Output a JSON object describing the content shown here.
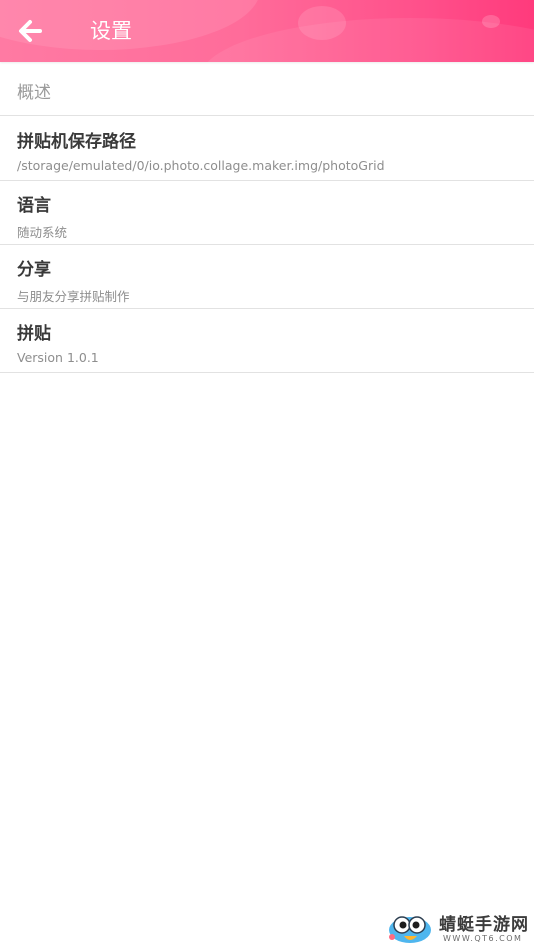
{
  "header": {
    "back_icon": "arrow-left-icon",
    "title": "设置",
    "gradient_colors": [
      "#ff7aa3",
      "#ff3a7c"
    ]
  },
  "section": {
    "label": "概述"
  },
  "preferences": [
    {
      "title": "拼贴机保存路径",
      "summary": "/storage/emulated/0/io.photo.collage.maker.img/photoGrid"
    },
    {
      "title": "语言",
      "summary": "随动系统"
    },
    {
      "title": "分享",
      "summary": "与朋友分享拼贴制作"
    },
    {
      "title": "拼贴",
      "summary": "Version 1.0.1"
    }
  ],
  "watermark": {
    "name": "蜻蜓手游网",
    "domain": "WWW.QT6.COM"
  }
}
